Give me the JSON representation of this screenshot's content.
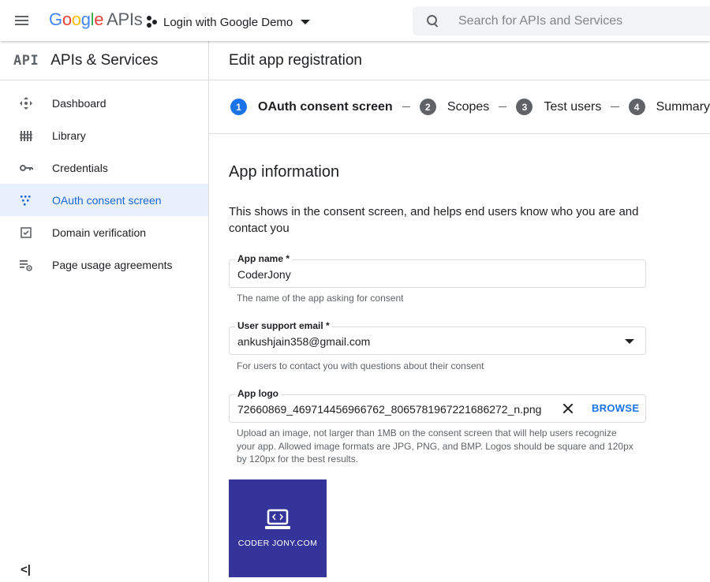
{
  "topbar": {
    "logo_letters": [
      "G",
      "o",
      "o",
      "g",
      "l",
      "e"
    ],
    "logo_suffix": "APIs",
    "project_name": "Login with Google Demo",
    "search_placeholder": "Search for APIs and Services",
    "icons": {
      "menu": "hamburger-menu-icon",
      "project": "project-dots-icon",
      "search": "search-icon"
    },
    "colors": {
      "blue": "#4285f4",
      "red": "#ea4335",
      "yellow": "#fbbc05",
      "green": "#34a853"
    }
  },
  "sidebar": {
    "badge": "API",
    "title": "APIs & Services",
    "items": [
      {
        "label": "Dashboard",
        "icon": "dashboard-icon",
        "active": false
      },
      {
        "label": "Library",
        "icon": "library-icon",
        "active": false
      },
      {
        "label": "Credentials",
        "icon": "key-icon",
        "active": false
      },
      {
        "label": "OAuth consent screen",
        "icon": "oauth-icon",
        "active": true
      },
      {
        "label": "Domain verification",
        "icon": "checkbox-icon",
        "active": false
      },
      {
        "label": "Page usage agreements",
        "icon": "settings-list-icon",
        "active": false
      }
    ],
    "collapse_label": "<|",
    "active_color": "#1967d2"
  },
  "main": {
    "title": "Edit app registration",
    "steps": [
      {
        "num": "1",
        "label": "OAuth consent screen",
        "current": true
      },
      {
        "num": "2",
        "label": "Scopes",
        "current": false
      },
      {
        "num": "3",
        "label": "Test users",
        "current": false
      },
      {
        "num": "4",
        "label": "Summary",
        "current": false
      }
    ],
    "section_title": "App information",
    "section_desc": "This shows in the consent screen, and helps end users know who you are and contact you",
    "app_name": {
      "label": "App name *",
      "value": "CoderJony",
      "hint": "The name of the app asking for consent"
    },
    "support_email": {
      "label": "User support email *",
      "value": "ankushjain358@gmail.com",
      "hint": "For users to contact you with questions about their consent"
    },
    "app_logo": {
      "label": "App logo",
      "value": "72660869_469714456966762_8065781967221686272_n.png",
      "browse_label": "BROWSE",
      "hint": "Upload an image, not larger than 1MB on the consent screen that will help users recognize your app. Allowed image formats are JPG, PNG, and BMP. Logos should be square and 120px by 120px for the best results."
    },
    "logo_preview_text": "CODER JONY.COM",
    "logo_preview_color": "#34349a",
    "accent_color": "#1a73e8"
  }
}
